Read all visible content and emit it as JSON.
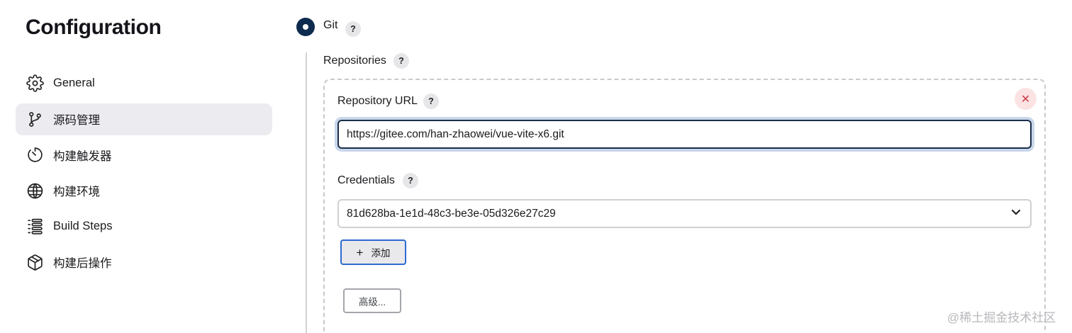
{
  "page_title": "Configuration",
  "sidebar": {
    "items": [
      {
        "label": "General",
        "icon": "gear-icon",
        "active": false
      },
      {
        "label": "源码管理",
        "icon": "git-branch-icon",
        "active": true
      },
      {
        "label": "构建触发器",
        "icon": "timer-icon",
        "active": false
      },
      {
        "label": "构建环境",
        "icon": "globe-icon",
        "active": false
      },
      {
        "label": "Build Steps",
        "icon": "list-steps-icon",
        "active": false
      },
      {
        "label": "构建后操作",
        "icon": "package-icon",
        "active": false
      }
    ]
  },
  "scm": {
    "option_label": "Git",
    "help": "?",
    "repositories_label": "Repositories",
    "repository_url_label": "Repository URL",
    "repository_url_value": "https://gitee.com/han-zhaowei/vue-vite-x6.git",
    "credentials_label": "Credentials",
    "credentials_value": "81d628ba-1e1d-48c3-be3e-05d326e27c29",
    "add_button_label": "添加",
    "add_button_icon": "plus-icon",
    "advanced_button_label": "高级...",
    "close_icon": "close-icon"
  },
  "watermark": "@稀土掘金技术社区",
  "colors": {
    "accent": "#0d2b4e",
    "focus_ring": "#c8d7ea",
    "danger": "#d03b46",
    "active_bg": "#ececf0"
  }
}
